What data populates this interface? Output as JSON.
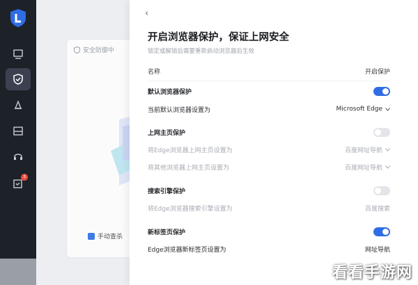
{
  "sidebar": {
    "icons": [
      "app-logo-icon",
      "monitor-icon",
      "shield-check-icon",
      "broom-icon",
      "toolbox-icon",
      "headset-icon",
      "message-icon"
    ],
    "badge": "3"
  },
  "background": {
    "card_header": "安全防御中",
    "manual_check": "手动查杀"
  },
  "panel": {
    "back_symbol": "‹",
    "title": "开启浏览器保护，保证上网安全",
    "subtitle": "锁定或解锁后需要重新启动浏览器后生效",
    "header": {
      "name": "名称",
      "status": "开启保护"
    },
    "sections": [
      {
        "title": "默认浏览器保护",
        "enabled": true,
        "setting_label": "当前默认浏览器设置为",
        "setting_value": "Microsoft Edge",
        "has_dropdown": true
      },
      {
        "title": "上网主页保护",
        "enabled": false,
        "settings": [
          {
            "label": "将Edge浏览器上网主页设置为",
            "value": "百度网址导航",
            "has_dropdown": true
          },
          {
            "label": "将其他浏览器上网主页设置为",
            "value": "百度网址导航",
            "has_dropdown": true
          }
        ]
      },
      {
        "title": "搜索引擎保护",
        "enabled": false,
        "setting_label": "将Edge浏览器搜索引擎设置为",
        "setting_value": "百度搜索",
        "has_dropdown": false
      },
      {
        "title": "新标签页保护",
        "enabled": true,
        "setting_label": "Edge浏览器新标签页设置为",
        "setting_value": "网址导航",
        "has_dropdown": false
      }
    ]
  },
  "watermark": "看看手游网",
  "colors": {
    "accent": "#2f6de5",
    "rail": "#1d2128",
    "badge": "#ef4b3f"
  }
}
